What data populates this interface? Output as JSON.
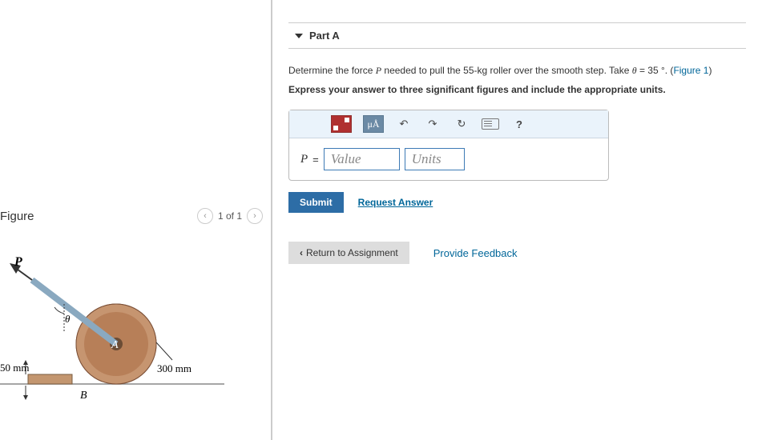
{
  "part": {
    "label": "Part A"
  },
  "prompt": {
    "text1": "Determine the force ",
    "Pvar": "P",
    "text2": " needed to pull the 55-kg roller over the smooth step. Take ",
    "theta": "θ",
    "text3": " = 35 °. (",
    "figlink": "Figure 1",
    "text4": ")",
    "instr": "Express your answer to three significant figures and include the appropriate units."
  },
  "toolbar": {
    "mu": "μÅ",
    "undo": "↶",
    "redo": "↷",
    "reset": "↻",
    "help": "?"
  },
  "input": {
    "Plabel": "P",
    "equals": " = ",
    "value_ph": "Value",
    "units_ph": "Units"
  },
  "actions": {
    "submit": "Submit",
    "request": "Request Answer",
    "return": "Return to Assignment",
    "feedback": "Provide Feedback"
  },
  "figure": {
    "title": "Figure",
    "page": "1 of 1",
    "Plabel": "P",
    "theta": "θ",
    "Alabel": "A",
    "Blabel": "B",
    "dim1": "50 mm",
    "dim2": "300 mm"
  }
}
